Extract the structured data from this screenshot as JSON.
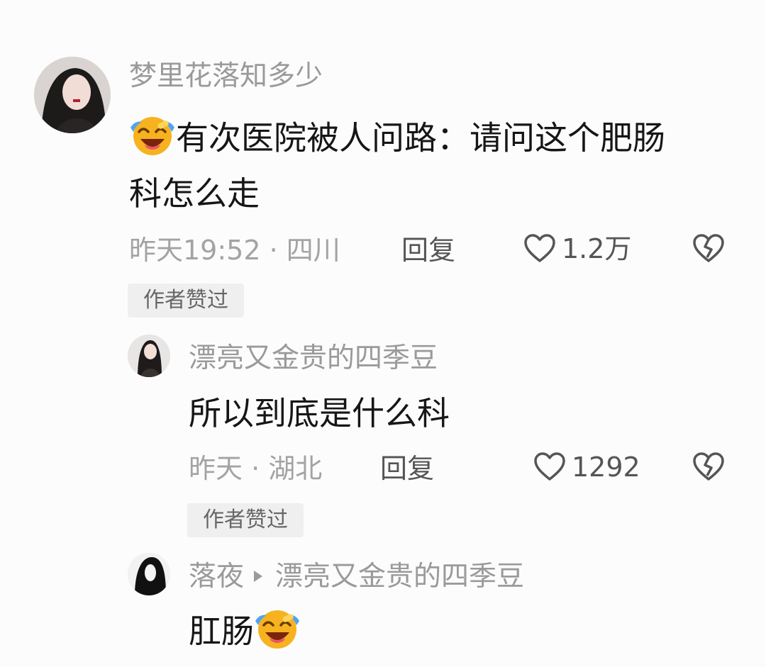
{
  "comments": [
    {
      "username": "梦里花落知多少",
      "text_line1": "有次医院被人问路：请问这个肥肠",
      "text_line2": "科怎么走",
      "time_location": "昨天19:52 · 四川",
      "reply_label": "回复",
      "likes": "1.2万",
      "badge": "作者赞过",
      "emoji": "laughing-crying-emoji"
    },
    {
      "username": "漂亮又金贵的四季豆",
      "text": "所以到底是什么科",
      "time_location": "昨天 · 湖北",
      "reply_label": "回复",
      "likes": "1292",
      "badge": "作者赞过"
    },
    {
      "username": "落夜",
      "reply_to": "漂亮又金贵的四季豆",
      "text": "肛肠",
      "emoji": "laughing-crying-emoji"
    }
  ],
  "colors": {
    "background": "#fcfcfc",
    "username": "#9a9a9a",
    "comment_text": "#161616",
    "meta": "#a3a3a3",
    "badge_bg": "#efefef",
    "emoji_face": "#f7b21f",
    "emoji_tears": "#4fa3f5"
  }
}
